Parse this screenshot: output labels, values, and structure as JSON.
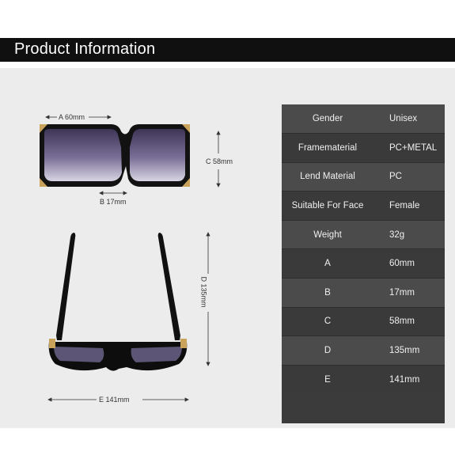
{
  "header": {
    "title": "Product Information"
  },
  "dimensions": {
    "a": "A 60mm",
    "b": "B 17mm",
    "c": "C 58mm",
    "d": "D 135mm",
    "e": "E 141mm"
  },
  "specs": [
    {
      "label": "Gender",
      "value": "Unisex"
    },
    {
      "label": "Framematerial",
      "value": "PC+METAL"
    },
    {
      "label": "Lend Material",
      "value": "PC"
    },
    {
      "label": "Suitable For Face",
      "value": "Female"
    },
    {
      "label": "Weight",
      "value": "32g"
    },
    {
      "label": "A",
      "value": "60mm"
    },
    {
      "label": "B",
      "value": "17mm"
    },
    {
      "label": "C",
      "value": "58mm"
    },
    {
      "label": "D",
      "value": "135mm"
    },
    {
      "label": "E",
      "value": "141mm"
    }
  ],
  "colors": {
    "header_bg": "#101010",
    "canvas_bg": "#ececec",
    "table_dark": "#3a3a3a",
    "table_light": "#4b4b4b",
    "lens": "#6a5f86",
    "frame": "#111111",
    "accent_gold": "#c9a25c"
  }
}
